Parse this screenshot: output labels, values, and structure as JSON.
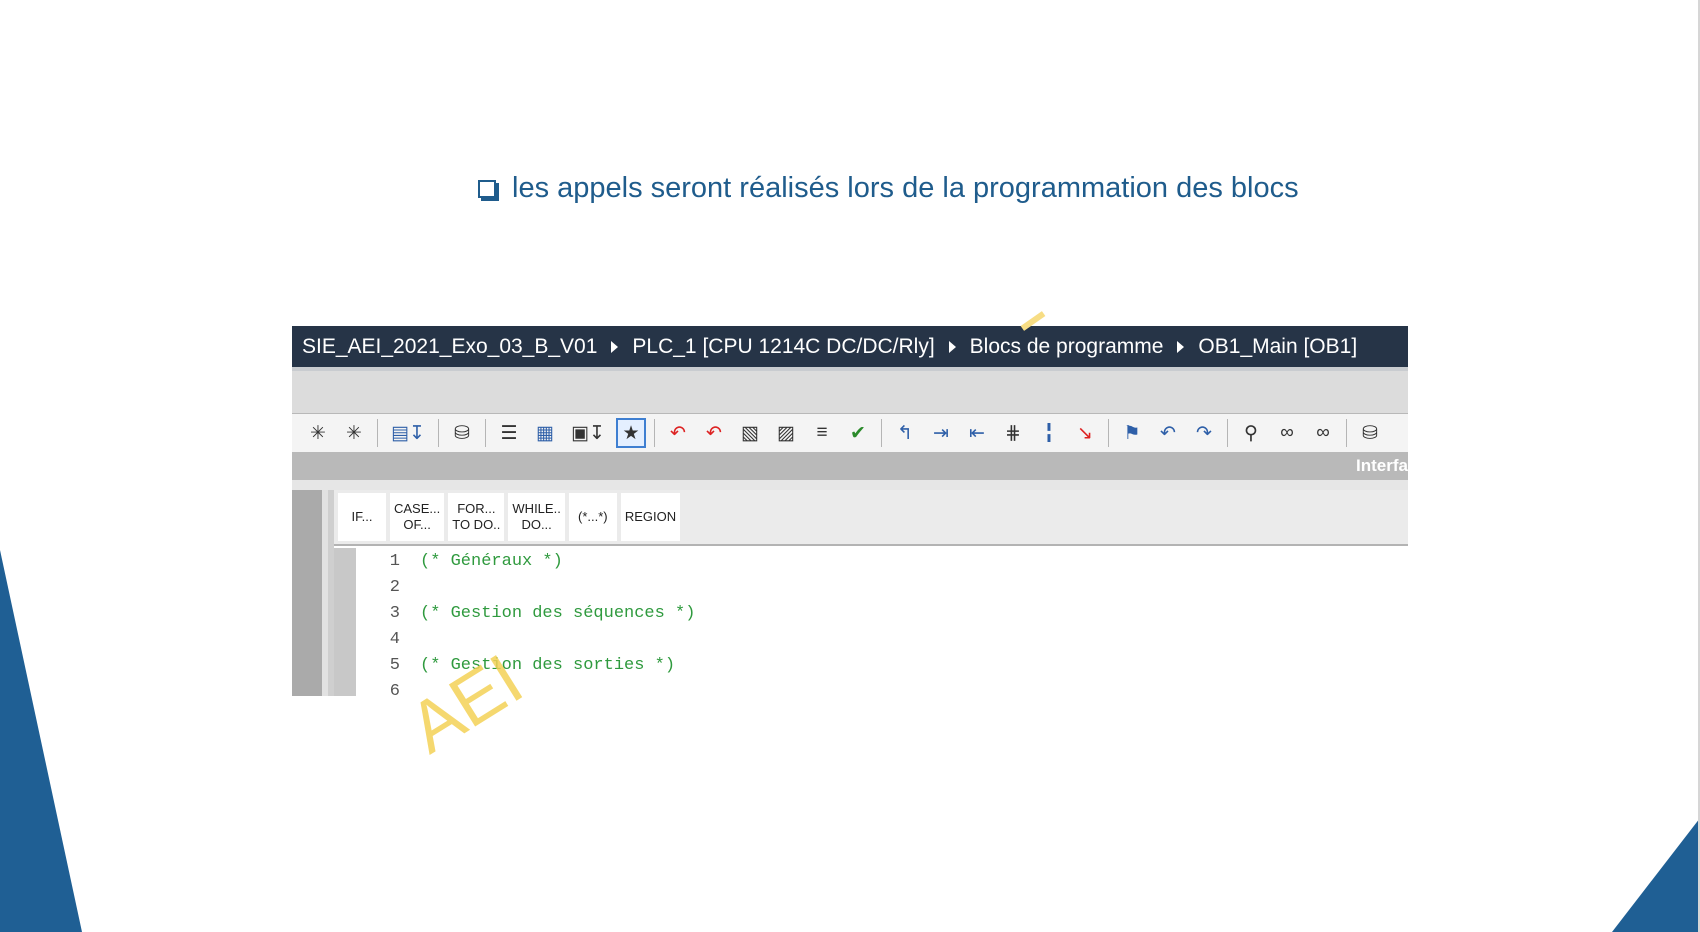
{
  "slide": {
    "bullet_text": "les appels seront réalisés lors de la programmation des blocs",
    "watermark": "AEI",
    "accent_color": "#1f5f94"
  },
  "breadcrumb": {
    "items": [
      "SIE_AEI_2021_Exo_03_B_V01",
      "PLC_1 [CPU 1214C DC/DC/Rly]",
      "Blocs de programme",
      "OB1_Main [OB1]"
    ]
  },
  "toolbar": {
    "icons": [
      "insert-network-icon",
      "delete-network-icon",
      "monitor-download-icon",
      "db-access-icon",
      "list-view-icon",
      "db-edit-icon",
      "tag-download-icon",
      "favorites-icon",
      "add-breakpoint-icon",
      "remove-breakpoint-icon",
      "show-tags-icon",
      "db-view-icon",
      "comment-lines-icon",
      "check-syntax-icon",
      "jump-back-icon",
      "indent-icon",
      "outdent-icon",
      "align-icon",
      "line-marker-icon",
      "step-marker-icon",
      "bookmark-icon",
      "previous-bookmark-icon",
      "next-bookmark-icon",
      "search-icon",
      "monitor-glasses-icon",
      "monitor-glasses-2-icon",
      "database-icon"
    ]
  },
  "interface_bar": {
    "label": "Interfa"
  },
  "keywords": [
    "IF...",
    "CASE...\nOF...",
    "FOR...\nTO DO..",
    "WHILE..\nDO...",
    "(*...*)",
    "REGION"
  ],
  "code_lines": [
    {
      "num": "1",
      "text": "(* Généraux *)"
    },
    {
      "num": "2",
      "text": ""
    },
    {
      "num": "3",
      "text": "(* Gestion des séquences *)"
    },
    {
      "num": "4",
      "text": ""
    },
    {
      "num": "5",
      "text": "(* Gestion des sorties *)"
    },
    {
      "num": "6",
      "text": ""
    }
  ]
}
